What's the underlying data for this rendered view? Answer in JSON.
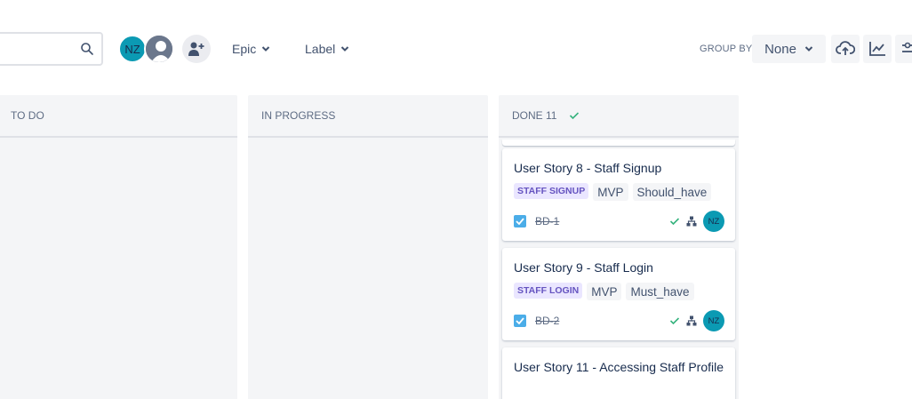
{
  "toolbar": {
    "avatar_initials": "NZ",
    "filters": [
      {
        "label": "Epic"
      },
      {
        "label": "Label"
      }
    ],
    "group_by_label": "GROUP BY",
    "group_by_value": "None"
  },
  "columns": [
    {
      "title": "TO DO"
    },
    {
      "title": "IN PROGRESS"
    },
    {
      "title": "DONE 11"
    }
  ],
  "cards": [
    {
      "title": "User Story 8 - Staff Signup",
      "epic": "STAFF SIGNUP",
      "labels": [
        "MVP",
        "Should_have"
      ],
      "key": "BD-1",
      "assignee": "NZ"
    },
    {
      "title": "User Story 9 - Staff Login",
      "epic": "STAFF LOGIN",
      "labels": [
        "MVP",
        "Must_have"
      ],
      "key": "BD-2",
      "assignee": "NZ"
    },
    {
      "title": "User Story 11 - Accessing Staff Profile"
    }
  ],
  "colors": {
    "accent_avatar": "#0b9ab3",
    "epic_bg": "#eae6ff",
    "epic_text": "#6554c0",
    "done_check": "#36b37e",
    "checkbox": "#4bade8"
  }
}
